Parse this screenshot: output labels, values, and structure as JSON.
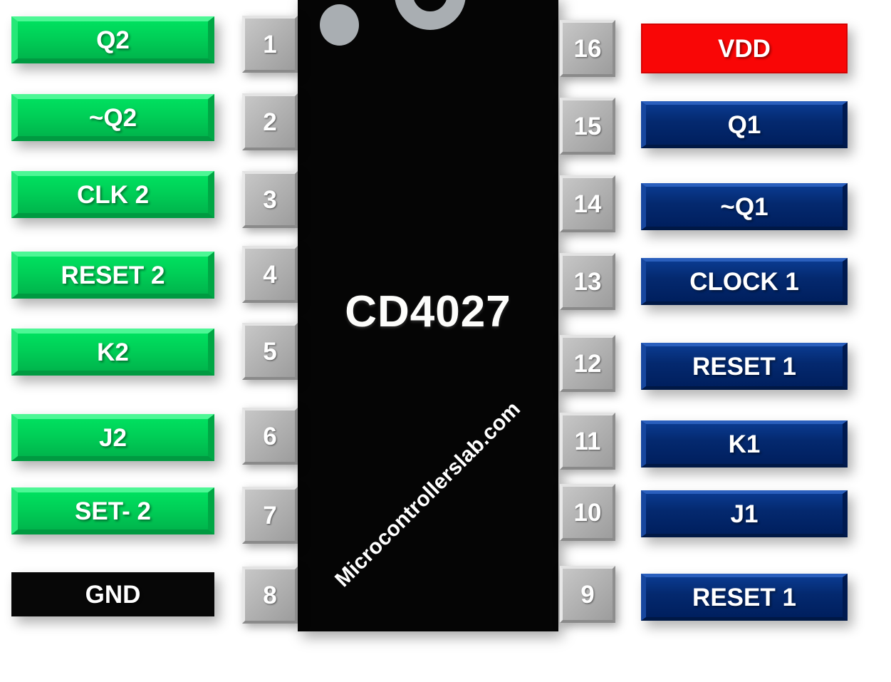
{
  "chip": {
    "part_number": "CD4027",
    "watermark": "Microcontrollerslab.com",
    "body_color": "#050505",
    "marker_color": "#a9aeb2"
  },
  "colors": {
    "green": "#00cf57",
    "blue": "#04296f",
    "red": "#f90606",
    "black": "#070707",
    "pin_box": "#b2b2b2"
  },
  "left_pins": [
    {
      "number": "1",
      "label": "Q2",
      "style": "green"
    },
    {
      "number": "2",
      "label": "~Q2",
      "style": "green"
    },
    {
      "number": "3",
      "label": "CLK 2",
      "style": "green"
    },
    {
      "number": "4",
      "label": "RESET 2",
      "style": "green"
    },
    {
      "number": "5",
      "label": "K2",
      "style": "green"
    },
    {
      "number": "6",
      "label": "J2",
      "style": "green"
    },
    {
      "number": "7",
      "label": "SET- 2",
      "style": "green"
    },
    {
      "number": "8",
      "label": "GND",
      "style": "black"
    }
  ],
  "right_pins": [
    {
      "number": "16",
      "label": "VDD",
      "style": "red"
    },
    {
      "number": "15",
      "label": "Q1",
      "style": "blue"
    },
    {
      "number": "14",
      "label": "~Q1",
      "style": "blue"
    },
    {
      "number": "13",
      "label": "CLOCK 1",
      "style": "blue"
    },
    {
      "number": "12",
      "label": "RESET 1",
      "style": "blue"
    },
    {
      "number": "11",
      "label": "K1",
      "style": "blue"
    },
    {
      "number": "10",
      "label": "J1",
      "style": "blue"
    },
    {
      "number": "9",
      "label": "RESET 1",
      "style": "blue"
    }
  ]
}
